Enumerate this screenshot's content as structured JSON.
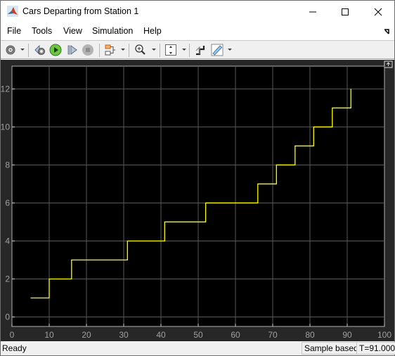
{
  "window": {
    "title": "Cars Departing from Station 1",
    "icon": "matlab-icon",
    "controls": [
      "minimize-icon",
      "maximize-icon",
      "close-icon"
    ]
  },
  "menu": {
    "items": [
      {
        "label": "File"
      },
      {
        "label": "Tools"
      },
      {
        "label": "View"
      },
      {
        "label": "Simulation"
      },
      {
        "label": "Help"
      }
    ],
    "undock_icon": "undock-arrow-icon"
  },
  "toolbar": {
    "buttons": [
      {
        "name": "settings",
        "icon": "gear-icon",
        "has_dropdown": true
      },
      {
        "name": "step-back",
        "icon": "step-back-icon"
      },
      {
        "name": "run",
        "icon": "run-icon",
        "color": "#3cb043"
      },
      {
        "name": "step-forward",
        "icon": "step-forward-icon"
      },
      {
        "name": "stop",
        "icon": "stop-icon",
        "disabled": true
      },
      {
        "name": "signal-selector",
        "icon": "signal-icon",
        "has_dropdown": true
      },
      {
        "name": "zoom-in",
        "icon": "zoom-in-icon",
        "has_dropdown": true
      },
      {
        "name": "scale-axes",
        "icon": "scale-y-icon",
        "has_dropdown": true
      },
      {
        "name": "triggers",
        "icon": "trigger-icon"
      },
      {
        "name": "measurements",
        "icon": "ruler-icon",
        "has_dropdown": true
      }
    ]
  },
  "status": {
    "text": "Ready",
    "mode": "Sample based",
    "time": "T=91.000"
  },
  "colors": {
    "plot_bg": "#000000",
    "scope_bg": "#272727",
    "line": "#ffff00",
    "grid": "#5a5a5a",
    "tick_text": "#a0a0a0"
  },
  "chart_data": {
    "type": "line",
    "style": "stairs",
    "title": "",
    "xlabel": "",
    "ylabel": "",
    "xlim": [
      0,
      100
    ],
    "ylim": [
      -0.5,
      13.2
    ],
    "grid": true,
    "legend": "none",
    "xticks": [
      0,
      10,
      20,
      30,
      40,
      50,
      60,
      70,
      80,
      90,
      100
    ],
    "yticks": [
      0,
      2,
      4,
      6,
      8,
      10,
      12
    ],
    "series": [
      {
        "name": "Cars Departing",
        "x": [
          5,
          10,
          16,
          31,
          41,
          52,
          66,
          71,
          76,
          81,
          86,
          91
        ],
        "y": [
          1,
          2,
          3,
          4,
          5,
          6,
          7,
          8,
          9,
          10,
          11,
          12
        ]
      }
    ]
  }
}
